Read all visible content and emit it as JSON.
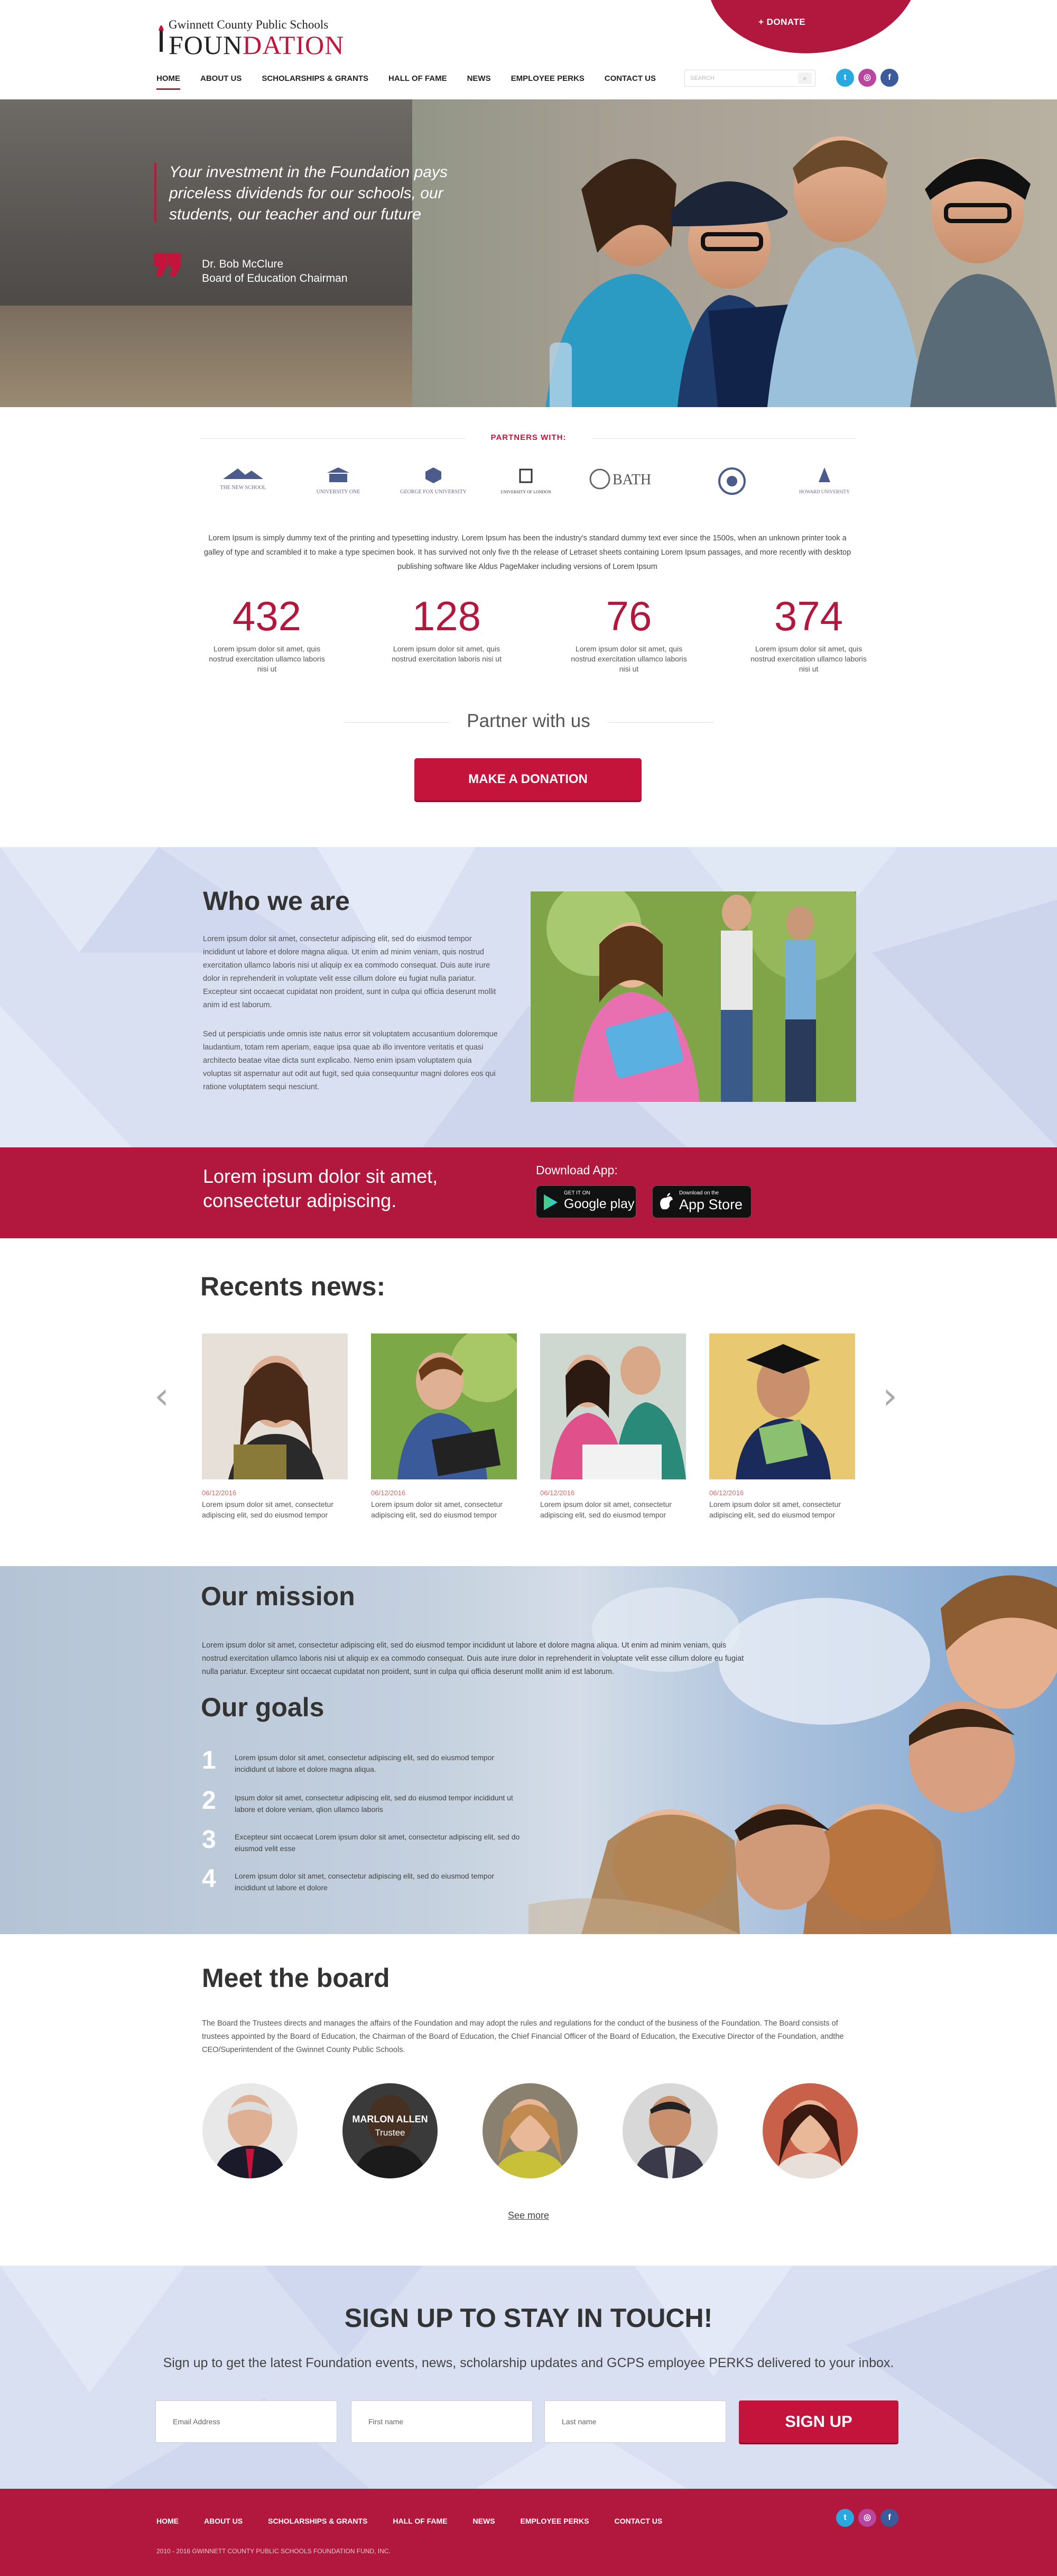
{
  "header": {
    "logo_top": "Gwinnett County Public Schools",
    "logo_main_prefix": "FOUN",
    "logo_main_suffix": "DATION",
    "donate_label": "+ DONATE",
    "search_placeholder": "SEARCH",
    "nav": [
      {
        "label": "HOME"
      },
      {
        "label": "ABOUT US"
      },
      {
        "label": "SCHOLARSHIPS & GRANTS"
      },
      {
        "label": "HALL OF FAME"
      },
      {
        "label": "NEWS"
      },
      {
        "label": "EMPLOYEE PERKS"
      },
      {
        "label": "CONTACT US"
      }
    ],
    "social": [
      {
        "icon": "twitter-icon",
        "glyph": "t",
        "color": "#29a9e0"
      },
      {
        "icon": "instagram-icon",
        "glyph": "◎",
        "color": "#b8459e"
      },
      {
        "icon": "facebook-icon",
        "glyph": "f",
        "color": "#3b5b9a"
      }
    ]
  },
  "hero": {
    "quote": "Your investment in the Foundation pays priceless dividends for our schools, our students, our teacher and our future",
    "author_name": "Dr. Bob McClure",
    "author_title": "Board of Education Chairman"
  },
  "partners": {
    "label": "PARTNERS WITH:",
    "logos": [
      {
        "icon": "the-new-school-logo-icon",
        "text": "THE NEW SCHOOL"
      },
      {
        "icon": "university-one-logo-icon",
        "text": "UNIVERSITY ONE"
      },
      {
        "icon": "george-fox-logo-icon",
        "text": "GEORGE FOX UNIVERSITY"
      },
      {
        "icon": "university-of-london-logo-icon",
        "text": "UNIVERSITY OF LONDON"
      },
      {
        "icon": "university-of-bath-logo-icon",
        "text": "BATH"
      },
      {
        "icon": "university-crest-logo-icon",
        "text": ""
      },
      {
        "icon": "howard-university-logo-icon",
        "text": "HOWARD UNIVERSITY"
      }
    ],
    "intro": "Lorem Ipsum is simply dummy text of the printing and typesetting industry. Lorem Ipsum has been the industry's standard dummy text ever since the 1500s, when an unknown printer took a galley of type and scrambled it to make a type specimen book. It has survived not only five th the release of Letraset sheets containing Lorem Ipsum passages, and more recently with desktop publishing software like Aldus PageMaker including versions of Lorem Ipsum"
  },
  "stats": [
    {
      "value": "432",
      "label": "Lorem ipsum dolor sit amet, quis nostrud exercitation ullamco laboris nisi ut"
    },
    {
      "value": "128",
      "label": "Lorem ipsum dolor sit amet, quis nostrud exercitation laboris nisi ut"
    },
    {
      "value": "76",
      "label": "Lorem ipsum dolor sit amet, quis nostrud exercitation ullamco laboris nisi ut"
    },
    {
      "value": "374",
      "label": "Lorem ipsum dolor sit amet, quis nostrud exercitation ullamco laboris nisi ut"
    }
  ],
  "partner_with": {
    "heading": "Partner with us",
    "button": "MAKE A DONATION"
  },
  "who": {
    "title": "Who we are",
    "p1": "Lorem ipsum dolor sit amet, consectetur adipiscing elit, sed do eiusmod tempor incididunt ut labore et dolore magna aliqua. Ut enim ad minim veniam, quis nostrud exercitation ullamco laboris nisi ut aliquip ex ea commodo consequat. Duis aute irure dolor in reprehenderit in voluptate velit esse cillum dolore eu fugiat nulla pariatur. Excepteur sint occaecat cupidatat non proident, sunt in culpa qui officia deserunt mollit anim id est laborum.",
    "p2": "Sed ut perspiciatis unde omnis iste natus error sit voluptatem accusantium doloremque laudantium, totam rem aperiam, eaque ipsa quae ab illo inventore veritatis et quasi architecto beatae vitae dicta sunt explicabo. Nemo enim ipsam voluptatem quia voluptas sit aspernatur aut odit aut fugit, sed quia consequuntur magni dolores eos qui ratione voluptatem sequi nesciunt."
  },
  "app": {
    "text": "Lorem ipsum dolor sit amet, consectetur adipiscing.",
    "download_label": "Download App:",
    "google_small": "GET IT ON",
    "google_big": "Google play",
    "apple_small": "Download on the",
    "apple_big": "App Store"
  },
  "news": {
    "title": "Recents news:",
    "items": [
      {
        "date": "06/12/2016",
        "text": "Lorem ipsum dolor sit amet, consectetur adipiscing elit, sed do eiusmod tempor"
      },
      {
        "date": "06/12/2016",
        "text": "Lorem ipsum dolor sit amet, consectetur adipiscing elit, sed do eiusmod tempor"
      },
      {
        "date": "06/12/2016",
        "text": "Lorem ipsum dolor sit amet, consectetur adipiscing elit, sed do eiusmod tempor"
      },
      {
        "date": "06/12/2016",
        "text": "Lorem ipsum dolor sit amet, consectetur adipiscing elit, sed do eiusmod tempor"
      }
    ]
  },
  "mission": {
    "title": "Our mission",
    "text": "Lorem ipsum dolor sit amet, consectetur adipiscing elit, sed do eiusmod tempor incididunt ut labore et dolore magna aliqua. Ut enim ad minim veniam, quis nostrud exercitation ullamco laboris nisi ut aliquip ex ea commodo consequat. Duis aute irure dolor in reprehenderit in voluptate velit esse cillum dolore eu fugiat nulla pariatur. Excepteur sint occaecat cupidatat non proident, sunt in culpa qui officia deserunt mollit anim id est laborum.",
    "goals_title": "Our goals",
    "goals": [
      {
        "num": "1",
        "text": "Lorem ipsum dolor sit amet, consectetur adipiscing elit, sed do eiusmod tempor incididunt ut labore et dolore magna aliqua."
      },
      {
        "num": "2",
        "text": "Ipsum dolor sit amet, consectetur adipiscing elit, sed do eiusmod tempor incididunt ut labore et dolore  veniam, qlion ullamco laboris"
      },
      {
        "num": "3",
        "text": "Excepteur sint occaecat Lorem ipsum dolor sit amet, consectetur adipiscing elit, sed do eiusmod  velit esse"
      },
      {
        "num": "4",
        "text": "Lorem ipsum dolor sit amet, consectetur adipiscing elit, sed do eiusmod tempor incididunt ut labore et dolore"
      }
    ]
  },
  "board": {
    "title": "Meet the board",
    "text": "The Board the Trustees directs and manages the affairs of the Foundation and may adopt the rules and regulations for the conduct of the business of the Foundation. The Board consists of trustees  appointed by the Board of Education, the Chairman of the Board of Education, the Chief Financial Officer of the Board of Education, the Executive Director of the Foundation, andthe CEO/Superintendent of the Gwinnet County Public Schools.",
    "highlight_name": "MARLON ALLEN",
    "highlight_role": "Trustee",
    "see_more": "See more"
  },
  "signup": {
    "title": "SIGN UP TO STAY IN TOUCH!",
    "subtitle": "Sign up to get the latest Foundation events, news, scholarship updates and GCPS employee PERKS delivered to your inbox.",
    "email_placeholder": "Email Address",
    "first_placeholder": "First name",
    "last_placeholder": "Last name",
    "button": "SIGN UP"
  },
  "footer": {
    "nav": [
      {
        "label": "HOME"
      },
      {
        "label": "ABOUT US"
      },
      {
        "label": "SCHOLARSHIPS & GRANTS"
      },
      {
        "label": "HALL OF FAME"
      },
      {
        "label": "NEWS"
      },
      {
        "label": "EMPLOYEE PERKS"
      },
      {
        "label": "CONTACT US"
      }
    ],
    "copyright": "2010 - 2016 GWINNETT COUNTY PUBLIC SCHOOLS FOUNDATION FUND, INC."
  },
  "colors": {
    "brand_red": "#c4143c",
    "band_red": "#b2173d",
    "light_blue": "#d8e0f2"
  }
}
